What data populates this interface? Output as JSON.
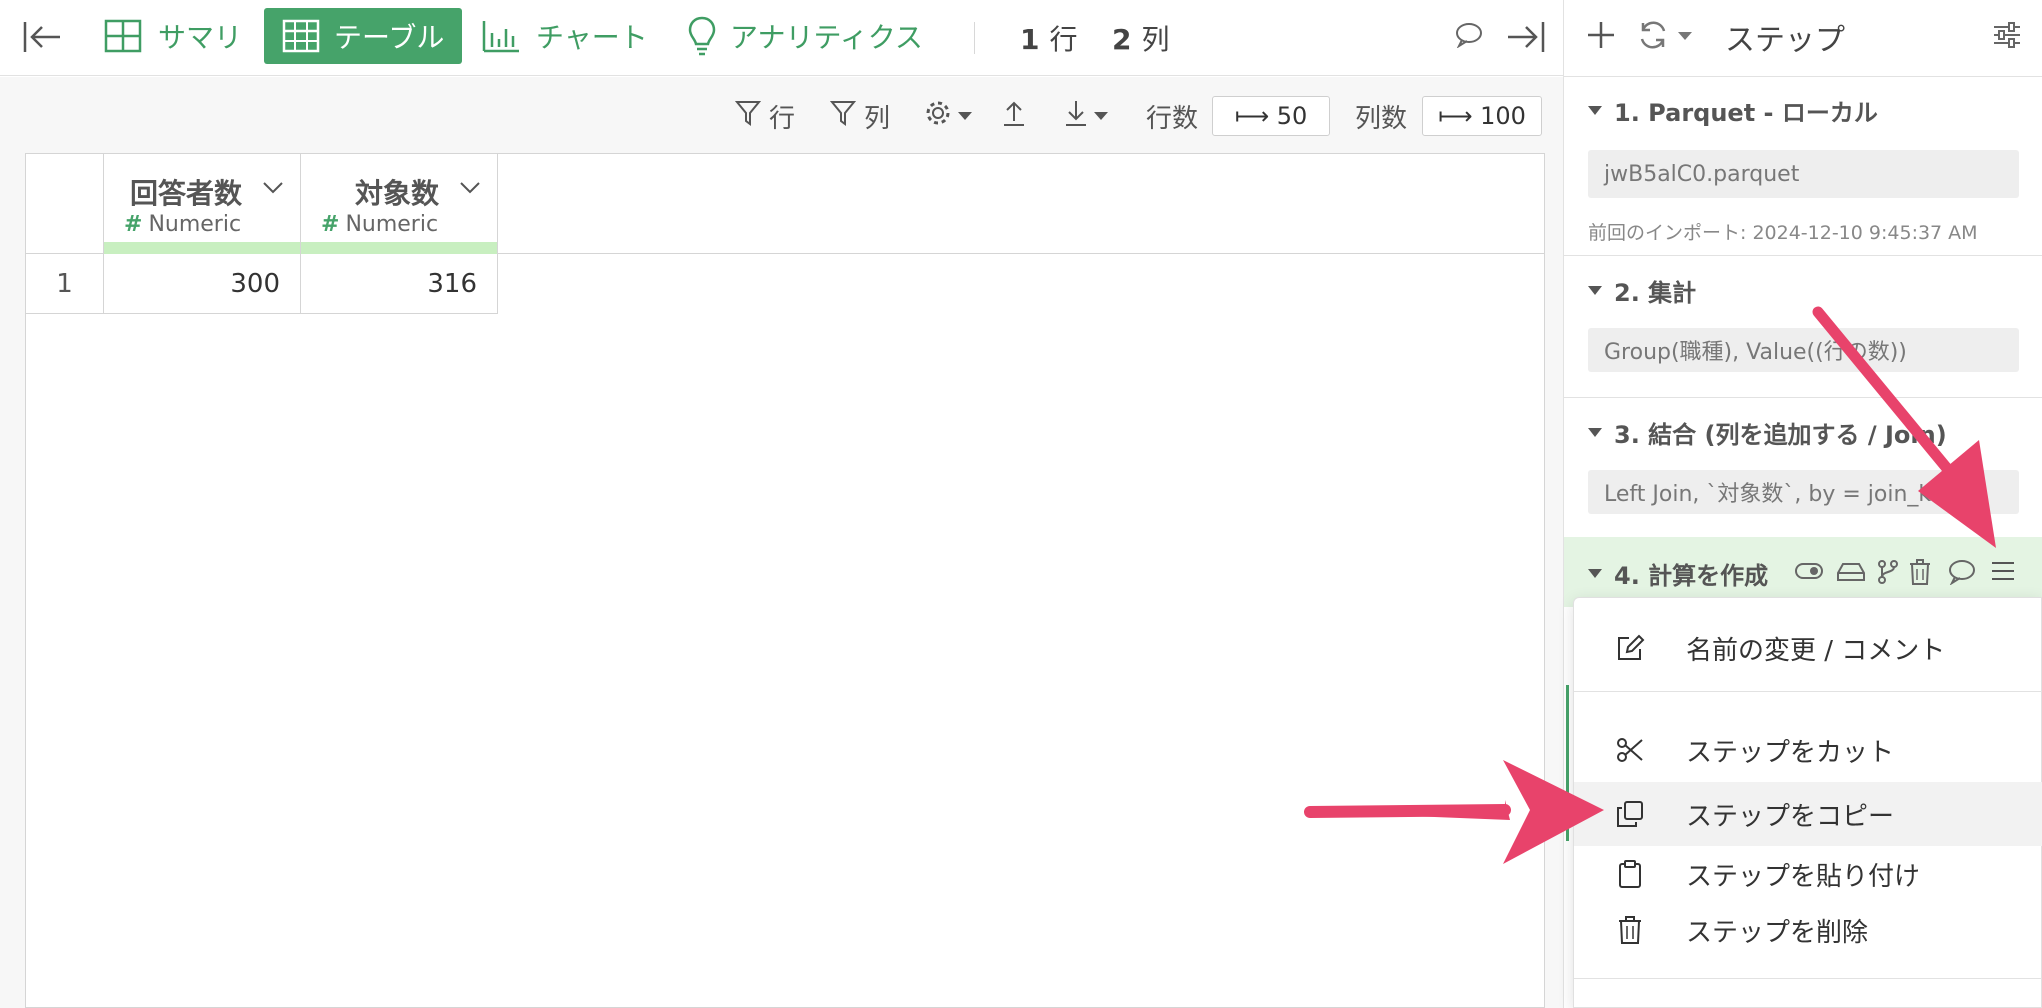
{
  "topbar": {
    "tabs": [
      {
        "id": "summary",
        "label": "サマリ",
        "icon": "grid-icon"
      },
      {
        "id": "table",
        "label": "テーブル",
        "icon": "table-icon",
        "active": true
      },
      {
        "id": "chart",
        "label": "チャート",
        "icon": "bar-chart-icon"
      },
      {
        "id": "analytics",
        "label": "アナリティクス",
        "icon": "lightbulb-icon"
      }
    ],
    "rows_count": "1",
    "rows_unit": "行",
    "cols_count": "2",
    "cols_unit": "列"
  },
  "toolbar": {
    "filter_rows_label": "行",
    "filter_cols_label": "列",
    "rows_label": "行数",
    "rows_value": "⟼ 50",
    "cols_label": "列数",
    "cols_value": "⟼ 100"
  },
  "table": {
    "columns": [
      {
        "name": "回答者数",
        "type": "Numeric"
      },
      {
        "name": "対象数",
        "type": "Numeric"
      }
    ],
    "rows": [
      {
        "index": "1",
        "values": [
          "300",
          "316"
        ]
      }
    ]
  },
  "panel": {
    "title": "ステップ",
    "steps": [
      {
        "label": "1. Parquet - ローカル",
        "detail": "jwB5alC0.parquet",
        "meta": "前回のインポート: 2024-12-10 9:45:37 AM"
      },
      {
        "label": "2. 集計",
        "detail": "Group(職種), Value((行の数))"
      },
      {
        "label": "3. 結合 (列を追加する / Join)",
        "detail": "Left Join, `対象数`, by = join_key..."
      },
      {
        "label": "4. 計算を作成"
      }
    ]
  },
  "menu": {
    "items": [
      {
        "label": "名前の変更 / コメント",
        "icon": "edit-icon"
      },
      {
        "label": "ステップをカット",
        "icon": "scissors-icon"
      },
      {
        "label": "ステップをコピー",
        "icon": "copy-icon"
      },
      {
        "label": "ステップを貼り付け",
        "icon": "clipboard-icon"
      },
      {
        "label": "ステップを削除",
        "icon": "trash-icon"
      }
    ]
  },
  "colors": {
    "accent": "#46a36a",
    "header_bar": "#c8efc0",
    "annotation_arrow": "#e8436b"
  }
}
